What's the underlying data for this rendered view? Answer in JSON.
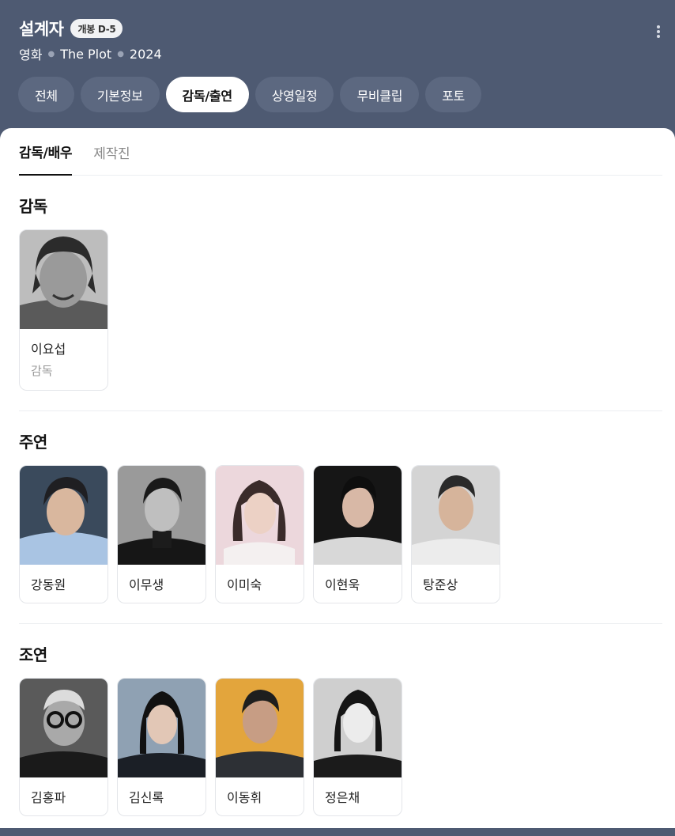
{
  "header": {
    "title": "설계자",
    "badge": "개봉 D-5",
    "meta": [
      "영화",
      "The Plot",
      "2024"
    ]
  },
  "tabs": [
    {
      "label": "전체",
      "active": false
    },
    {
      "label": "기본정보",
      "active": false
    },
    {
      "label": "감독/출연",
      "active": true
    },
    {
      "label": "상영일정",
      "active": false
    },
    {
      "label": "무비클립",
      "active": false
    },
    {
      "label": "포토",
      "active": false
    }
  ],
  "subtabs": [
    {
      "label": "감독/배우",
      "active": true
    },
    {
      "label": "제작진",
      "active": false
    }
  ],
  "sections": {
    "director": {
      "title": "감독",
      "people": [
        {
          "name": "이요섭",
          "role": "감독"
        }
      ]
    },
    "lead": {
      "title": "주연",
      "people": [
        {
          "name": "강동원"
        },
        {
          "name": "이무생"
        },
        {
          "name": "이미숙"
        },
        {
          "name": "이현욱"
        },
        {
          "name": "탕준상"
        }
      ]
    },
    "support": {
      "title": "조연",
      "people": [
        {
          "name": "김홍파"
        },
        {
          "name": "김신록"
        },
        {
          "name": "이동휘"
        },
        {
          "name": "정은채"
        }
      ]
    }
  },
  "colors": {
    "header_bg": "#4e5a72",
    "tab_bg": "#5c6880",
    "active_tab_bg": "#ffffff"
  }
}
